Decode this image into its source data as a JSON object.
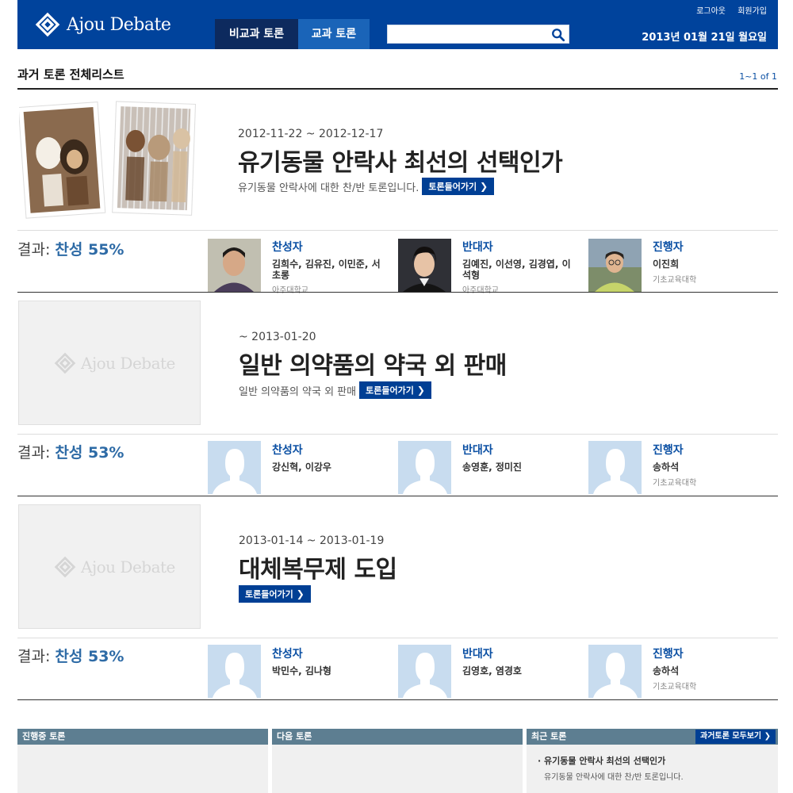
{
  "header": {
    "logo_text": "Ajou Debate",
    "tabs": [
      "비교과 토론",
      "교과 토론"
    ],
    "search_placeholder": "",
    "logout": "로그아웃",
    "signup": "회원가입",
    "date": "2013년 01월 21일 월요일"
  },
  "list": {
    "title": "과거 토론 전체리스트",
    "pager": "1~1 of 1"
  },
  "debates": [
    {
      "period": "2012-11-22 ~ 2012-12-17",
      "title": "유기동물 안락사 최선의 선택인가",
      "description": "유기동물 안락사에 대한 찬/반 토론입니다.",
      "enter_label": "토론들어가기",
      "result_label": "결과:",
      "result_value": "찬성 55%",
      "pro": {
        "title": "찬성자",
        "names": "김희수, 김유진, 이민준, 서초롱",
        "affiliation": "아주대학교"
      },
      "con": {
        "title": "반대자",
        "names": "김예진, 이선영, 김경엽, 이석형",
        "affiliation": "아주대학교"
      },
      "moderator": {
        "title": "진행자",
        "names": "이진희",
        "affiliation": "기초교육대학"
      }
    },
    {
      "period": "~ 2013-01-20",
      "title": "일반 의약품의 약국 외 판매",
      "description": "일반 의약품의 약국 외 판매",
      "enter_label": "토론들어가기",
      "image_placeholder": "Ajou Debate",
      "result_label": "결과:",
      "result_value": "찬성 53%",
      "pro": {
        "title": "찬성자",
        "names": "강신혁, 이강우"
      },
      "con": {
        "title": "반대자",
        "names": "송영훈, 정미진"
      },
      "moderator": {
        "title": "진행자",
        "names": "송하석",
        "affiliation": "기초교육대학"
      }
    },
    {
      "period": "2013-01-14 ~ 2013-01-19",
      "title": "대체복무제 도입",
      "enter_label": "토론들어가기",
      "image_placeholder": "Ajou Debate",
      "result_label": "결과:",
      "result_value": "찬성 53%",
      "pro": {
        "title": "찬성자",
        "names": "박민수, 김나형"
      },
      "con": {
        "title": "반대자",
        "names": "김영호, 염경호"
      },
      "moderator": {
        "title": "진행자",
        "names": "송하석",
        "affiliation": "기초교육대학"
      }
    }
  ],
  "panels": {
    "ongoing": "진행중 토론",
    "next": "다음 토론",
    "recent": "최근 토론",
    "recent_all_button": "과거토론 모두보기",
    "recent_item_title": "유기동물 안락사 최선의 선택인가",
    "recent_item_desc": "유기동물 안락사에 대한 찬/반 토론입니다."
  },
  "colors": {
    "brand": "#00439c",
    "accent_blue": "#0a4fa3",
    "result_blue": "#2e6ba6",
    "panel_header": "#5d7e91"
  }
}
